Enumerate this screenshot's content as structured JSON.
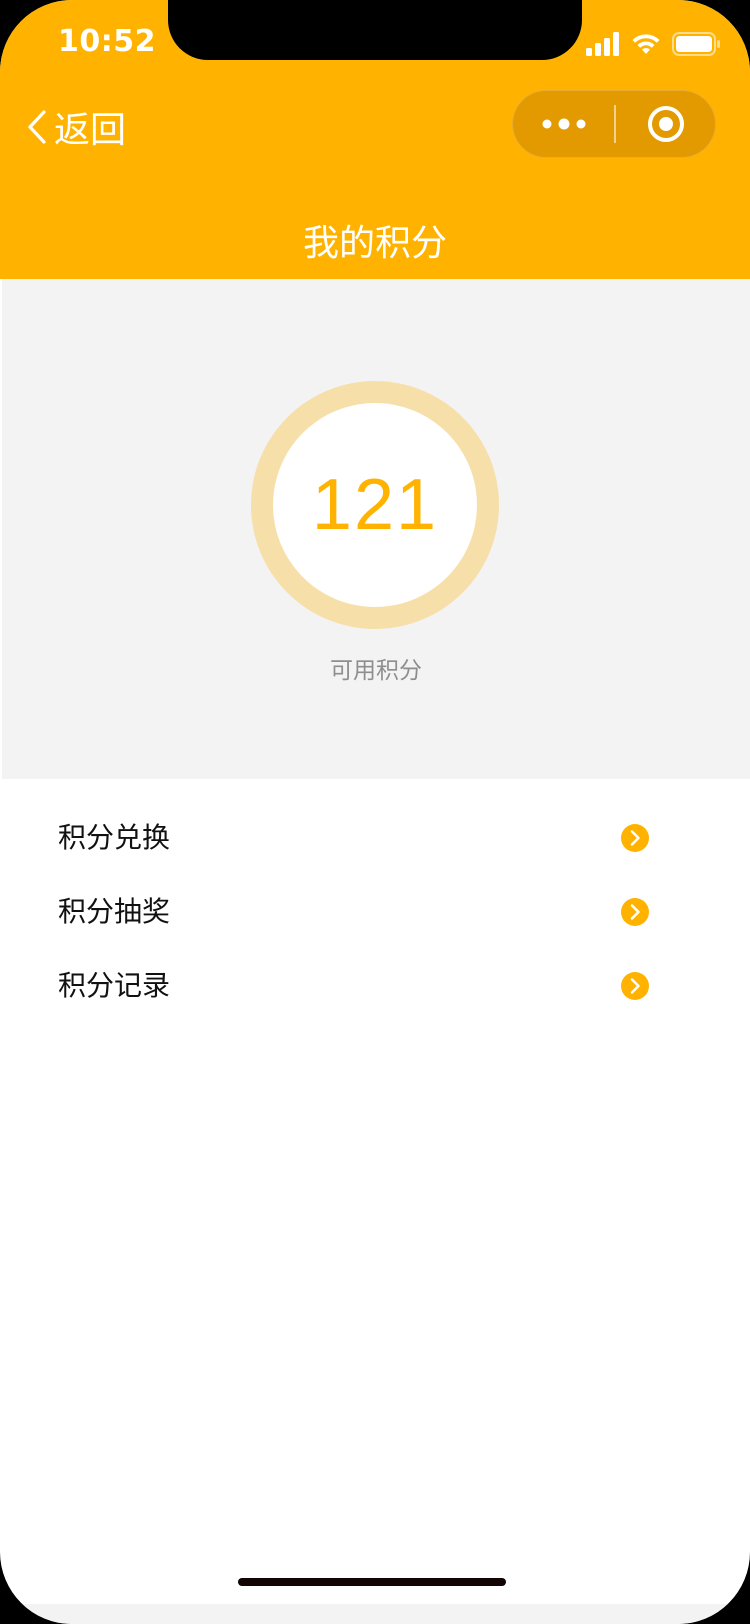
{
  "status_bar": {
    "time": "10:52",
    "signal_icon": "cellular-signal-icon",
    "wifi_icon": "wifi-icon",
    "battery_icon": "battery-icon"
  },
  "nav": {
    "back_label": "返回",
    "back_icon": "chevron-left-icon",
    "more_icon": "more-dots-icon",
    "close_icon": "target-close-icon",
    "title": "我的积分"
  },
  "points": {
    "value": "121",
    "label": "可用积分"
  },
  "menu": {
    "items": [
      {
        "label": "积分兑换",
        "icon": "chevron-right-circle-icon"
      },
      {
        "label": "积分抽奖",
        "icon": "chevron-right-circle-icon"
      },
      {
        "label": "积分记录",
        "icon": "chevron-right-circle-icon"
      }
    ]
  },
  "colors": {
    "accent": "#FFB300",
    "ring": "#F7DFA9",
    "background_gray": "#F3F3F4",
    "label_gray": "#8E8E8E"
  }
}
